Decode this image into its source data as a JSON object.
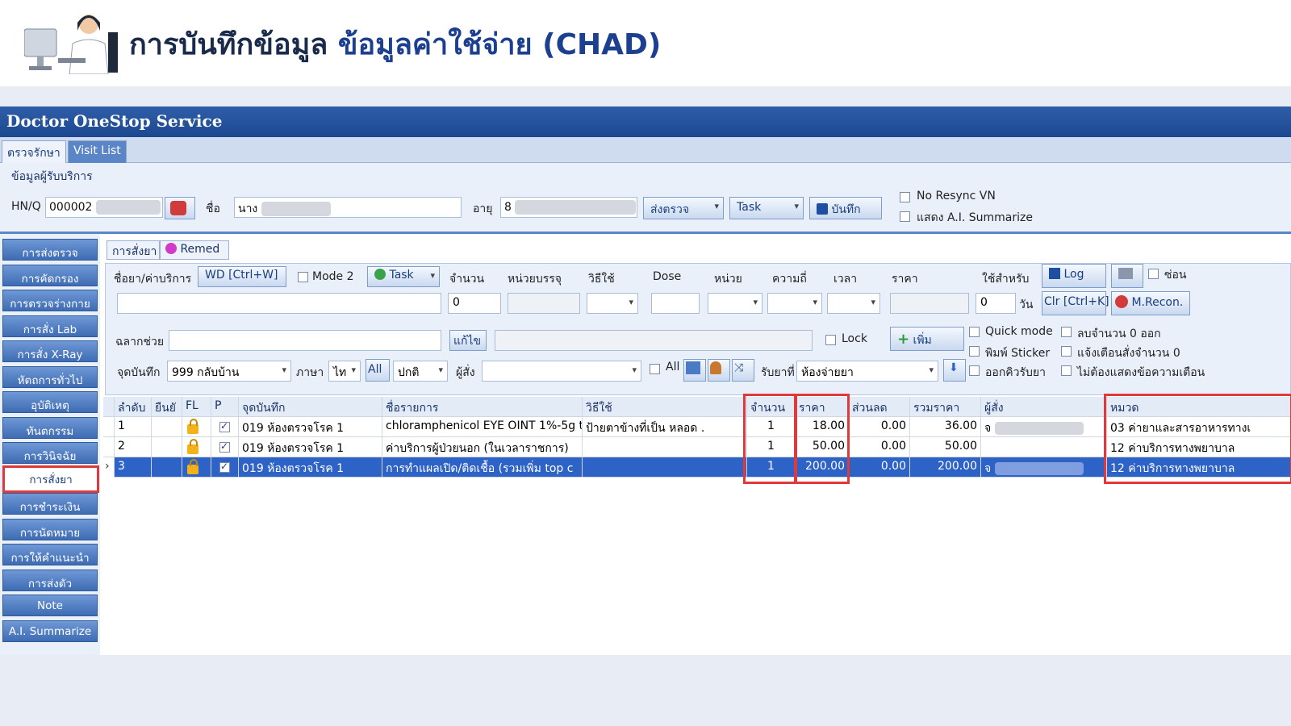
{
  "slide": {
    "title_main": "การบันทึกข้อมูล",
    "title_accent": "ข้อมูลค่าใช้จ่าย (CHAD)"
  },
  "app": {
    "title": "Doctor OneStop Service"
  },
  "tabs": [
    "ตรวจรักษา",
    "Visit List"
  ],
  "patient": {
    "section_label": "ข้อมูลผู้รับบริการ",
    "hn_label": "HN/Q",
    "hn_value": "000002",
    "name_label": "ชื่อ",
    "name_value": "นาง",
    "age_label": "อายุ",
    "age_value": "8",
    "send_label": "ส่งตรวจ",
    "task_label": "Task",
    "save_label": "บันทึก",
    "no_resync": "No Resync VN",
    "ai_summarize": "แสดง A.I. Summarize"
  },
  "sidebar": [
    "การส่งตรวจ",
    "การคัดกรอง",
    "การตรวจร่างกาย",
    "การสั่ง Lab",
    "การสั่ง X-Ray",
    "หัตถการทั่วไป",
    "อุบัติเหตุ",
    "ทันตกรรม",
    "การวินิจฉัย",
    "การสั่งยา",
    "การชำระเงิน",
    "การนัดหมาย",
    "การให้คำแนะนำ",
    "การส่งตัว",
    "Note",
    "A.I. Summarize"
  ],
  "subtabs": [
    "การสั่งยา",
    "Remed"
  ],
  "order": {
    "drug_label": "ชื่อยา/ค่าบริการ",
    "wd_button": "WD [Ctrl+W]",
    "mode2": "Mode 2",
    "task": "Task",
    "headers": [
      "จำนวน",
      "หน่วยบรรจุ",
      "วิธีใช้",
      "Dose",
      "หน่วย",
      "ความถี่",
      "เวลา",
      "ราคา",
      "ใช้สำหรับ"
    ],
    "qty_value": "0",
    "use_days_value": "0",
    "day_unit": "วัน",
    "log": "Log",
    "hide": "ซ่อน",
    "clr": "Clr [Ctrl+K]",
    "mrecon": "M.Recon.",
    "label_help": "ฉลากช่วย",
    "edit": "แก้ไข",
    "lock": "Lock",
    "add": "เพิ่ม",
    "quick_mode": "Quick mode",
    "remove_zero": "ลบจำนวน 0 ออก",
    "print_sticker": "พิมพ์ Sticker",
    "warn_qty": "แจ้งเตือนสั่งจำนวน 0",
    "queue": "ออกคิวรับยา",
    "no_warn": "ไม่ต้องแสดงข้อความเตือน",
    "point_label": "จุดบันทึก",
    "point_value": "999 กลับบ้าน",
    "lang_label": "ภาษา",
    "lang_value": "ไท",
    "all_btn": "All",
    "normal_value": "ปกติ",
    "orderer_label": "ผู้สั่ง",
    "all_chk": "All",
    "receive_label": "รับยาที่",
    "receive_value": "ห้องจ่ายยา"
  },
  "grid": {
    "headers": [
      "ลำดับ",
      "ยืนยั",
      "FL",
      "P",
      "จุดบันทึก",
      "ชื่อรายการ",
      "วิธีใช้",
      "จำนวน",
      "ราคา",
      "ส่วนลด",
      "รวมราคา",
      "ผู้สั่ง",
      "หมวด"
    ],
    "rows": [
      {
        "no": "1",
        "point": "019 ห้องตรวจโรค 1",
        "name": "chloramphenicol EYE OINT 1%-5g t",
        "usage": "ป้ายตาข้างที่เป็น หลอด .",
        "qty": "1",
        "price": "18.00",
        "discount": "0.00",
        "total": "36.00",
        "orderer": "จ",
        "category": "03 ค่ายาและสารอาหารทางเ"
      },
      {
        "no": "2",
        "point": "019 ห้องตรวจโรค 1",
        "name": "ค่าบริการผู้ป่วยนอก (ในเวลาราชการ)",
        "usage": "",
        "qty": "1",
        "price": "50.00",
        "discount": "0.00",
        "total": "50.00",
        "orderer": "",
        "category": "12 ค่าบริการทางพยาบาล"
      },
      {
        "no": "3",
        "point": "019 ห้องตรวจโรค 1",
        "name": "การทำแผลเปิด/ติดเชื้อ (รวมเพิ่ม top c",
        "usage": "",
        "qty": "1",
        "price": "200.00",
        "discount": "0.00",
        "total": "200.00",
        "orderer": "จ",
        "category": "12 ค่าบริการทางพยาบาล"
      }
    ]
  }
}
